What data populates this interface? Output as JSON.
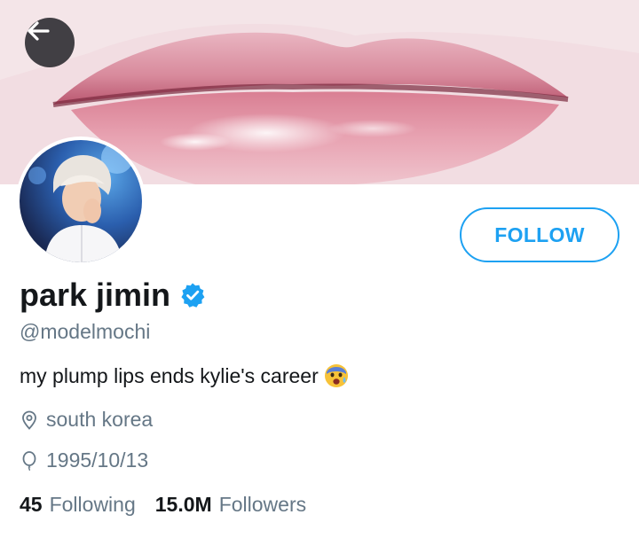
{
  "profile": {
    "display_name": "park jimin",
    "handle": "@modelmochi",
    "bio": "my plump lips ends kylie's career",
    "bio_emoji": "😰",
    "location": "south korea",
    "birthday": "1995/10/13",
    "verified": true
  },
  "actions": {
    "follow_label": "FOLLOW",
    "back_icon": "back-arrow-icon"
  },
  "stats": {
    "following_count": "45",
    "following_label": "Following",
    "followers_count": "15.0M",
    "followers_label": "Followers"
  },
  "icons": {
    "location": "location-pin-icon",
    "birthday": "balloon-icon",
    "verified": "verified-badge-icon"
  },
  "colors": {
    "accent": "#1da1f2",
    "text_primary": "#14171a",
    "text_secondary": "#657786"
  }
}
